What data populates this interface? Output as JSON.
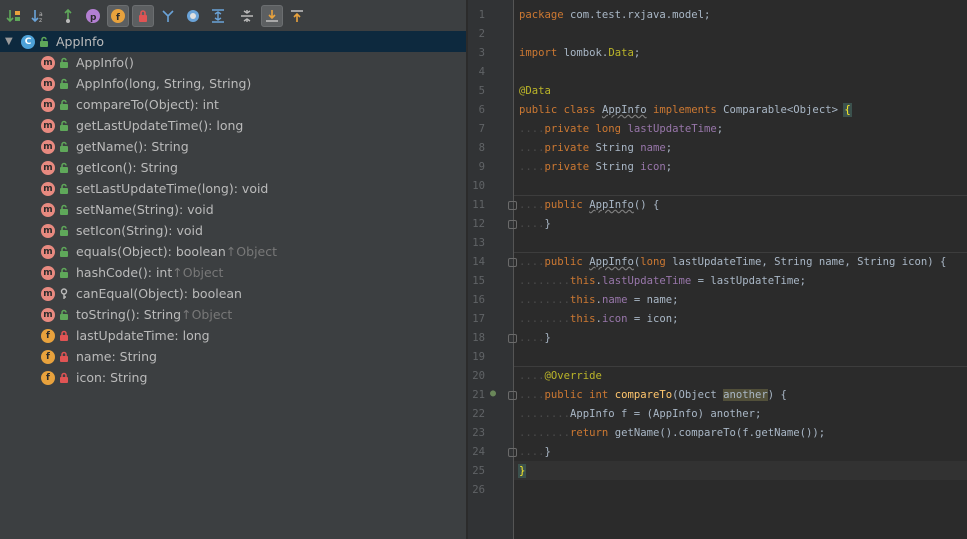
{
  "structure": {
    "toolbar": [
      {
        "name": "sort-by-visibility-icon",
        "active": false
      },
      {
        "name": "sort-alphabetically-icon",
        "active": false
      },
      {
        "name": "show-inherited-icon",
        "active": false
      },
      {
        "name": "show-properties-icon",
        "active": false
      },
      {
        "name": "show-fields-icon",
        "active": true
      },
      {
        "name": "show-non-public-icon",
        "active": true
      },
      {
        "name": "show-lambdas-icon",
        "active": false
      },
      {
        "name": "show-anonymous-icon",
        "active": false
      },
      {
        "name": "expand-all-icon",
        "active": false
      },
      {
        "name": "collapse-all-icon",
        "active": false
      },
      {
        "name": "autoscroll-to-source-icon",
        "active": true
      },
      {
        "name": "autoscroll-from-source-icon",
        "active": false
      }
    ],
    "root": {
      "badge": "C",
      "label": "AppInfo"
    },
    "members": [
      {
        "kind": "m",
        "vis": "public",
        "label": "AppInfo()",
        "inherit": ""
      },
      {
        "kind": "m",
        "vis": "public",
        "label": "AppInfo(long, String, String)",
        "inherit": ""
      },
      {
        "kind": "m",
        "vis": "public",
        "label": "compareTo(Object): int",
        "inherit": ""
      },
      {
        "kind": "m",
        "vis": "public",
        "label": "getLastUpdateTime(): long",
        "inherit": ""
      },
      {
        "kind": "m",
        "vis": "public",
        "label": "getName(): String",
        "inherit": ""
      },
      {
        "kind": "m",
        "vis": "public",
        "label": "getIcon(): String",
        "inherit": ""
      },
      {
        "kind": "m",
        "vis": "public",
        "label": "setLastUpdateTime(long): void",
        "inherit": ""
      },
      {
        "kind": "m",
        "vis": "public",
        "label": "setName(String): void",
        "inherit": ""
      },
      {
        "kind": "m",
        "vis": "public",
        "label": "setIcon(String): void",
        "inherit": ""
      },
      {
        "kind": "m",
        "vis": "public",
        "label": "equals(Object): boolean ",
        "inherit": "↑Object"
      },
      {
        "kind": "m",
        "vis": "public",
        "label": "hashCode(): int ",
        "inherit": "↑Object"
      },
      {
        "kind": "m",
        "vis": "protected",
        "label": "canEqual(Object): boolean",
        "inherit": ""
      },
      {
        "kind": "m",
        "vis": "public",
        "label": "toString(): String ",
        "inherit": "↑Object"
      },
      {
        "kind": "f",
        "vis": "private",
        "label": "lastUpdateTime: long",
        "inherit": ""
      },
      {
        "kind": "f",
        "vis": "private",
        "label": "name: String",
        "inherit": ""
      },
      {
        "kind": "f",
        "vis": "private",
        "label": "icon: String",
        "inherit": ""
      }
    ]
  },
  "editor": {
    "lines": [
      {
        "n": "1",
        "html": "<span class=\"kw\">package</span> com.test.rxjava.model;"
      },
      {
        "n": "2",
        "html": ""
      },
      {
        "n": "3",
        "html": "<span class=\"kw\">import</span> lombok.<span class=\"ann\">Data</span>;"
      },
      {
        "n": "4",
        "html": ""
      },
      {
        "n": "5",
        "html": "<span class=\"ann\">@Data</span>"
      },
      {
        "n": "6",
        "html": "<span class=\"kw\">public class</span> <span class=\"und\">AppInfo</span> <span class=\"kw\">implements</span> Comparable&lt;Object&gt; <span class=\"brace\">{</span>"
      },
      {
        "n": "7",
        "html": "<span class=\"ws\">....</span><span class=\"kw\">private long</span> <span class=\"fld\">lastUpdateTime</span>;"
      },
      {
        "n": "8",
        "html": "<span class=\"ws\">....</span><span class=\"kw\">private</span> String <span class=\"fld\">name</span>;"
      },
      {
        "n": "9",
        "html": "<span class=\"ws\">....</span><span class=\"kw\">private</span> String <span class=\"fld\">icon</span>;"
      },
      {
        "n": "10",
        "html": ""
      },
      {
        "n": "11",
        "html": "<span class=\"ws\">....</span><span class=\"kw\">public</span> <span class=\"und\">AppInfo</span>() {"
      },
      {
        "n": "12",
        "html": "<span class=\"ws\">....</span>}"
      },
      {
        "n": "13",
        "html": ""
      },
      {
        "n": "14",
        "html": "<span class=\"ws\">....</span><span class=\"kw\">public</span> <span class=\"und\">AppInfo</span>(<span class=\"kw\">long</span> lastUpdateTime, String name, String icon) {"
      },
      {
        "n": "15",
        "html": "<span class=\"ws\">........</span><span class=\"kw\">this</span>.<span class=\"fld\">lastUpdateTime</span> = lastUpdateTime;"
      },
      {
        "n": "16",
        "html": "<span class=\"ws\">........</span><span class=\"kw\">this</span>.<span class=\"fld\">name</span> = name;"
      },
      {
        "n": "17",
        "html": "<span class=\"ws\">........</span><span class=\"kw\">this</span>.<span class=\"fld\">icon</span> = icon;"
      },
      {
        "n": "18",
        "html": "<span class=\"ws\">....</span>}"
      },
      {
        "n": "19",
        "html": ""
      },
      {
        "n": "20",
        "html": "<span class=\"ws\">....</span><span class=\"ann\">@Override</span>"
      },
      {
        "n": "21",
        "html": "<span class=\"ws\">....</span><span class=\"kw\">public int</span> <span class=\"mth\">compareTo</span>(Object <span class=\"hl2\">another</span>) {"
      },
      {
        "n": "22",
        "html": "<span class=\"ws\">........</span>AppInfo f = (AppInfo) another;"
      },
      {
        "n": "23",
        "html": "<span class=\"ws\">........</span><span class=\"kw\">return</span> getName().compareTo(f.getName());"
      },
      {
        "n": "24",
        "html": "<span class=\"ws\">....</span>}"
      },
      {
        "n": "25",
        "html": "<span class=\"brace\">}</span><span class=\"caret\"></span>"
      },
      {
        "n": "26",
        "html": ""
      }
    ]
  }
}
